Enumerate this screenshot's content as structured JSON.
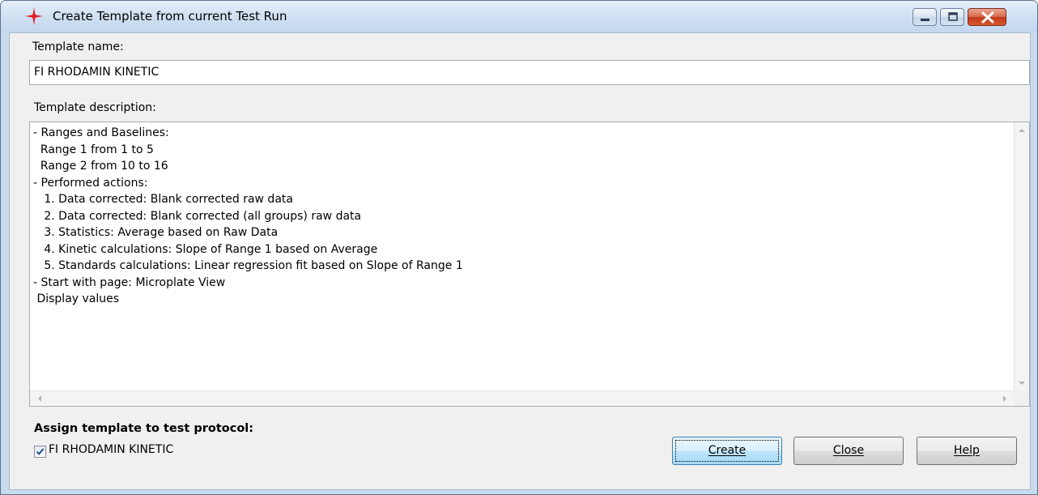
{
  "window": {
    "title": "Create Template from current Test Run",
    "icon": "crosshair-icon"
  },
  "form": {
    "name_label": "Template name:",
    "name_value": "FI RHODAMIN KINETIC",
    "description_label": "Template description:",
    "description_lines": [
      "- Ranges and Baselines:",
      "  Range 1 from 1 to 5",
      "  Range 2 from 10 to 16",
      "- Performed actions:",
      "   1. Data corrected: Blank corrected raw data",
      "   2. Data corrected: Blank corrected (all groups) raw data",
      "   3. Statistics: Average based on Raw Data",
      "   4. Kinetic calculations: Slope of Range 1 based on Average",
      "   5. Standards calculations: Linear regression fit based on Slope of Range 1",
      "- Start with page: Microplate View",
      " Display values"
    ],
    "assign_label": "Assign template to test protocol:",
    "checkbox_label": "FI RHODAMIN KINETIC",
    "checkbox_checked": true
  },
  "buttons": {
    "create": "Create",
    "close": "Close",
    "help": "Help"
  },
  "colors": {
    "title_bar": "#c9dbef",
    "close_button": "#c2381b",
    "icon_red": "#e0201f"
  }
}
